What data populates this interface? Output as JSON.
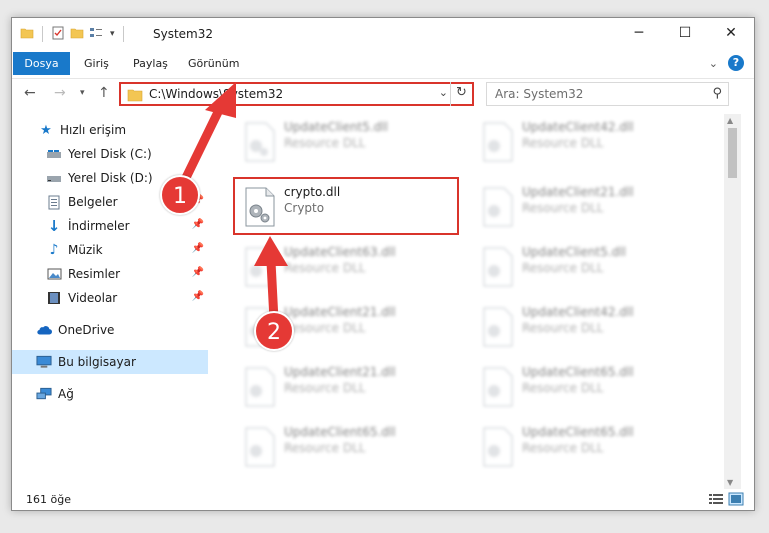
{
  "window": {
    "title": "System32"
  },
  "ribbon": {
    "tabs": [
      "Dosya",
      "Giriş",
      "Paylaş",
      "Görünüm"
    ]
  },
  "nav": {
    "address_path": "C:\\Windows\\System32",
    "search_placeholder": "Ara: System32"
  },
  "sidebar": {
    "quick_access": "Hızlı erişim",
    "items": [
      {
        "label": "Yerel Disk (C:)",
        "icon": "drive-icon",
        "pinned": false
      },
      {
        "label": "Yerel Disk (D:)",
        "icon": "drive-icon",
        "pinned": false
      },
      {
        "label": "Belgeler",
        "icon": "documents-icon",
        "pinned": true
      },
      {
        "label": "İndirmeler",
        "icon": "download-icon",
        "pinned": true
      },
      {
        "label": "Müzik",
        "icon": "music-icon",
        "pinned": true
      },
      {
        "label": "Resimler",
        "icon": "pictures-icon",
        "pinned": true
      },
      {
        "label": "Videolar",
        "icon": "videos-icon",
        "pinned": true
      }
    ],
    "onedrive": "OneDrive",
    "this_pc": "Bu bilgisayar",
    "network": "Ağ"
  },
  "files": {
    "left_column": [
      {
        "name": "UpdateClient5.dll",
        "type": "Resource DLL"
      },
      {
        "name": "crypto.dll",
        "type": "Crypto"
      },
      {
        "name": "UpdateClient63.dll",
        "type": "Resource DLL"
      },
      {
        "name": "UpdateClient21.dll",
        "type": "Resource DLL"
      },
      {
        "name": "UpdateClient21.dll",
        "type": "Resource DLL"
      },
      {
        "name": "UpdateClient65.dll",
        "type": "Resource DLL"
      }
    ],
    "right_column": [
      {
        "name": "UpdateClient42.dll",
        "type": "Resource DLL"
      },
      {
        "name": "UpdateClient21.dll",
        "type": "Resource DLL"
      },
      {
        "name": "UpdateClient5.dll",
        "type": "Resource DLL"
      },
      {
        "name": "UpdateClient42.dll",
        "type": "Resource DLL"
      },
      {
        "name": "UpdateClient65.dll",
        "type": "Resource DLL"
      },
      {
        "name": "UpdateClient65.dll",
        "type": "Resource DLL"
      }
    ]
  },
  "status": {
    "item_count": "161 öğe"
  },
  "annotations": {
    "step1": "1",
    "step2": "2"
  },
  "colors": {
    "accent": "#1979ca",
    "highlight": "#d9342b",
    "badge": "#e53935"
  }
}
